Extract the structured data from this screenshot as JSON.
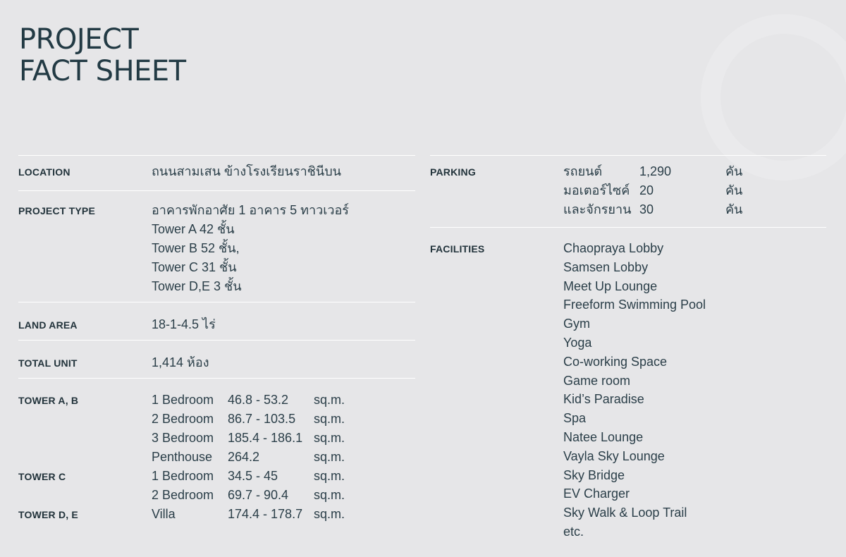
{
  "title": {
    "line1": "PROJECT",
    "line2": "FACT SHEET"
  },
  "location": {
    "label": "LOCATION",
    "value": "ถนนสามเสน ข้างโรงเรียนราชินีบน"
  },
  "project_type": {
    "label": "PROJECT TYPE",
    "lines": [
      "อาคารพักอาศัย 1 อาคาร 5 ทาวเวอร์",
      "Tower A 42 ชั้น",
      "Tower B 52 ชั้น,",
      "Tower C 31 ชั้น",
      "Tower D,E 3 ชั้น"
    ]
  },
  "land_area": {
    "label": "LAND AREA",
    "value": "18-1-4.5 ไร่"
  },
  "total_unit": {
    "label": "TOTAL UNIT",
    "value": "1,414 ห้อง"
  },
  "towers": [
    {
      "label": "TOWER A, B",
      "rows": [
        {
          "type": "1 Bedroom",
          "size": "46.8 - 53.2",
          "unit": "sq.m."
        },
        {
          "type": "2 Bedroom",
          "size": "86.7 - 103.5",
          "unit": "sq.m."
        },
        {
          "type": "3 Bedroom",
          "size": "185.4 - 186.1",
          "unit": "sq.m."
        },
        {
          "type": "Penthouse",
          "size": "264.2",
          "unit": "sq.m."
        }
      ]
    },
    {
      "label": "TOWER C",
      "rows": [
        {
          "type": "1 Bedroom",
          "size": "34.5 - 45",
          "unit": "sq.m."
        },
        {
          "type": "2 Bedroom",
          "size": "69.7 - 90.4",
          "unit": "sq.m."
        }
      ]
    },
    {
      "label": "TOWER D, E",
      "rows": [
        {
          "type": "Villa",
          "size": "174.4 - 178.7",
          "unit": "sq.m."
        }
      ]
    }
  ],
  "parking": {
    "label": "PARKING",
    "rows": [
      {
        "type": "รถยนต์",
        "count": "1,290",
        "unit": "คัน"
      },
      {
        "type": "มอเตอร์ไซค์",
        "count": "20",
        "unit": "คัน"
      },
      {
        "type": "และจักรยาน",
        "count": "30",
        "unit": "คัน"
      }
    ]
  },
  "facilities": {
    "label": "FACILITIES",
    "items": [
      "Chaopraya Lobby",
      "Samsen Lobby",
      "Meet Up Lounge",
      "Freeform Swimming Pool",
      "Gym",
      "Yoga",
      "Co-working Space",
      "Game room",
      "Kid’s Paradise",
      "Spa",
      "Natee Lounge",
      "Vayla Sky Lounge",
      "Sky Bridge",
      "EV Charger",
      "Sky Walk & Loop Trail",
      "etc."
    ]
  }
}
